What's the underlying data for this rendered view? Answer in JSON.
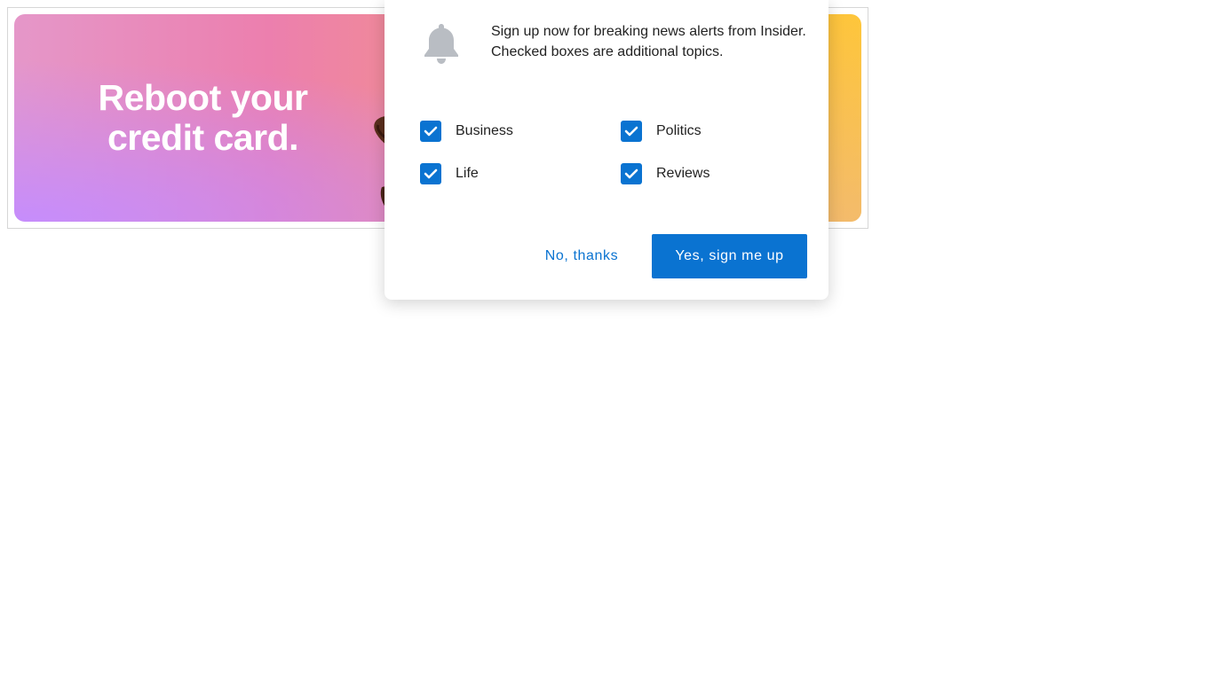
{
  "ad": {
    "headline": "Reboot your credit card."
  },
  "prompt": {
    "message": "Sign up now for breaking news alerts from Insider. Checked boxes are additional topics.",
    "topics": [
      {
        "label": "Business",
        "checked": true
      },
      {
        "label": "Politics",
        "checked": true
      },
      {
        "label": "Life",
        "checked": true
      },
      {
        "label": "Reviews",
        "checked": true
      }
    ],
    "decline_label": "No, thanks",
    "accept_label": "Yes, sign me up"
  },
  "colors": {
    "accent": "#0a73d1",
    "bell": "#b9bdc3",
    "text": "#222222"
  },
  "icons": {
    "bell": "bell-icon",
    "check": "checkmark-icon"
  }
}
